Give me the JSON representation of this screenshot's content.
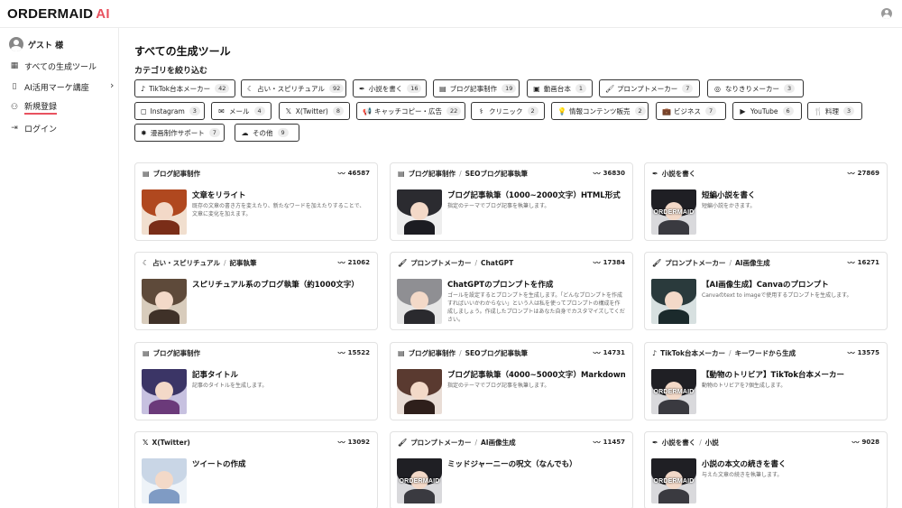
{
  "app": {
    "logo_text": "ORDERMAID",
    "logo_ai": "AI"
  },
  "sidebar": {
    "items": [
      {
        "label": "ゲスト 様",
        "icon": "user-avatar-icon"
      },
      {
        "label": "すべての生成ツール",
        "icon": "grid-icon"
      },
      {
        "label": "AI活用マーケ講座",
        "icon": "book-icon"
      },
      {
        "label": "新規登録",
        "icon": "add-user-icon"
      },
      {
        "label": "ログイン",
        "icon": "login-icon"
      }
    ]
  },
  "main": {
    "title": "すべての生成ツール",
    "filter_label": "カテゴリを絞り込む",
    "chips": [
      {
        "label": "TikTok台本メーカー",
        "count": "42",
        "icon": "tiktok-icon"
      },
      {
        "label": "占い・スピリチュアル",
        "count": "92",
        "icon": "moon-icon"
      },
      {
        "label": "小説を書く",
        "count": "16",
        "icon": "pen-icon"
      },
      {
        "label": "ブログ記事制作",
        "count": "19",
        "icon": "document-icon"
      },
      {
        "label": "動画台本",
        "count": "1",
        "icon": "video-icon"
      },
      {
        "label": "プロンプトメーカー",
        "count": "7",
        "icon": "brush-icon"
      },
      {
        "label": "なりきりメーカー",
        "count": "3",
        "icon": "mask-icon"
      },
      {
        "label": "Instagram",
        "count": "3",
        "icon": "instagram-icon"
      },
      {
        "label": "メール",
        "count": "4",
        "icon": "mail-icon"
      },
      {
        "label": "X(Twitter)",
        "count": "8",
        "icon": "x-icon"
      },
      {
        "label": "キャッチコピー・広告",
        "count": "22",
        "icon": "megaphone-icon"
      },
      {
        "label": "クリニック",
        "count": "2",
        "icon": "doctor-icon"
      },
      {
        "label": "情報コンテンツ販売",
        "count": "2",
        "icon": "lightbulb-icon"
      },
      {
        "label": "ビジネス",
        "count": "7",
        "icon": "briefcase-icon"
      },
      {
        "label": "YouTube",
        "count": "6",
        "icon": "youtube-icon"
      },
      {
        "label": "料理",
        "count": "3",
        "icon": "utensils-icon"
      },
      {
        "label": "漫画制作サポート",
        "count": "7",
        "icon": "burst-icon"
      },
      {
        "label": "その他",
        "count": "9",
        "icon": "cloud-icon"
      }
    ],
    "cards": [
      {
        "category": "ブログ記事制作",
        "sub": "",
        "views": "46587",
        "title": "文章をリライト",
        "desc": "既存の文章の書き方を変えたり、新たなワードを加えたりすることで、文章に変化を加えます。",
        "icon": "document-icon",
        "hair": "#b0481f",
        "cloth": "#7a2d18",
        "bg": "#f1dfcf",
        "watermark": ""
      },
      {
        "category": "ブログ記事制作",
        "sub": "SEOブログ記事執筆",
        "views": "36830",
        "title": "ブログ記事執筆（1000~2000文字）HTML形式",
        "desc": "指定のテーマでブログ記事を執筆します。",
        "icon": "document-icon",
        "hair": "#2b2b30",
        "cloth": "#1c1c22",
        "bg": "#eeeeee",
        "watermark": ""
      },
      {
        "category": "小説を書く",
        "sub": "",
        "views": "27869",
        "title": "短編小説を書く",
        "desc": "短編小説をかきます。",
        "icon": "pen-icon",
        "hair": "#1f1f24",
        "cloth": "#3a3a40",
        "bg": "#d9d9dc",
        "watermark": "ORDERMAID"
      },
      {
        "category": "占い・スピリチュアル",
        "sub": "記事執筆",
        "views": "21062",
        "title": "スピリチュアル系のブログ執筆（約1000文字）",
        "desc": "",
        "icon": "moon-icon",
        "hair": "#5e4a3a",
        "cloth": "#3f3128",
        "bg": "#d8ccbc",
        "watermark": ""
      },
      {
        "category": "プロンプトメーカー",
        "sub": "ChatGPT",
        "views": "17384",
        "title": "ChatGPTのプロンプトを作成",
        "desc": "ゴールを設定するとプロンプトを生成します。「どんなプロンプトを作成すればいいかわからない」という人は私を使ってプロンプトの構成を作成しましょう。作成したプロンプトはあなた自身でカスタマイズしてください。",
        "icon": "brush-icon",
        "hair": "#8f8f93",
        "cloth": "#2a2a2e",
        "bg": "#e6e6e6",
        "watermark": ""
      },
      {
        "category": "プロンプトメーカー",
        "sub": "AI画像生成",
        "views": "16271",
        "title": "【AI画像生成】Canvaのプロンプト",
        "desc": "Canvaのtext to imageで使用するプロンプトを生成します。",
        "icon": "brush-icon",
        "hair": "#2a3a3c",
        "cloth": "#1b2a2c",
        "bg": "#d7e0e0",
        "watermark": ""
      },
      {
        "category": "ブログ記事制作",
        "sub": "",
        "views": "15522",
        "title": "記事タイトル",
        "desc": "記事のタイトルを生成します。",
        "icon": "document-icon",
        "hair": "#3b3566",
        "cloth": "#6b3a7a",
        "bg": "#c7c1e0",
        "watermark": ""
      },
      {
        "category": "ブログ記事制作",
        "sub": "SEOブログ記事執筆",
        "views": "14731",
        "title": "ブログ記事執筆（4000~5000文字）Markdown形式",
        "desc": "指定のテーマでブログ記事を執筆します。",
        "icon": "document-icon",
        "hair": "#5a3a30",
        "cloth": "#2e1f1b",
        "bg": "#e9ddd6",
        "watermark": ""
      },
      {
        "category": "TikTok台本メーカー",
        "sub": "キーワードから生成",
        "views": "13575",
        "title": "【動物のトリビア】TikTok台本メーカー",
        "desc": "動物のトリビアを7個生成します。",
        "icon": "tiktok-icon",
        "hair": "#1f1f24",
        "cloth": "#3a3a40",
        "bg": "#d9d9dc",
        "watermark": "ORDERMAID"
      },
      {
        "category": "X(Twitter)",
        "sub": "",
        "views": "13092",
        "title": "ツイートの作成",
        "desc": "",
        "icon": "x-icon",
        "hair": "#c9d6e6",
        "cloth": "#7f9bc4",
        "bg": "#eef3f8",
        "watermark": ""
      },
      {
        "category": "プロンプトメーカー",
        "sub": "AI画像生成",
        "views": "11457",
        "title": "ミッドジャーニーの呪文（なんでも）",
        "desc": "",
        "icon": "brush-icon",
        "hair": "#1f1f24",
        "cloth": "#3a3a40",
        "bg": "#d9d9dc",
        "watermark": "ORDERMAID"
      },
      {
        "category": "小説を書く",
        "sub": "小説",
        "views": "9028",
        "title": "小説の本文の続きを書く",
        "desc": "与えた文章の続きを執筆します。",
        "icon": "pen-icon",
        "hair": "#1f1f24",
        "cloth": "#3a3a40",
        "bg": "#d9d9dc",
        "watermark": "ORDERMAID"
      }
    ]
  },
  "icons": {
    "tiktok-icon": "♪",
    "moon-icon": "☾",
    "pen-icon": "✒",
    "document-icon": "▤",
    "video-icon": "▣",
    "brush-icon": "🖌",
    "mask-icon": "◎",
    "instagram-icon": "◻",
    "mail-icon": "✉",
    "x-icon": "𝕏",
    "megaphone-icon": "📢",
    "doctor-icon": "⚕",
    "lightbulb-icon": "💡",
    "briefcase-icon": "💼",
    "youtube-icon": "▶",
    "utensils-icon": "🍴",
    "burst-icon": "✸",
    "cloud-icon": "☁",
    "grid-icon": "▦",
    "book-icon": "▯",
    "add-user-icon": "⚇",
    "login-icon": "⇥",
    "trend-icon": "〰"
  }
}
